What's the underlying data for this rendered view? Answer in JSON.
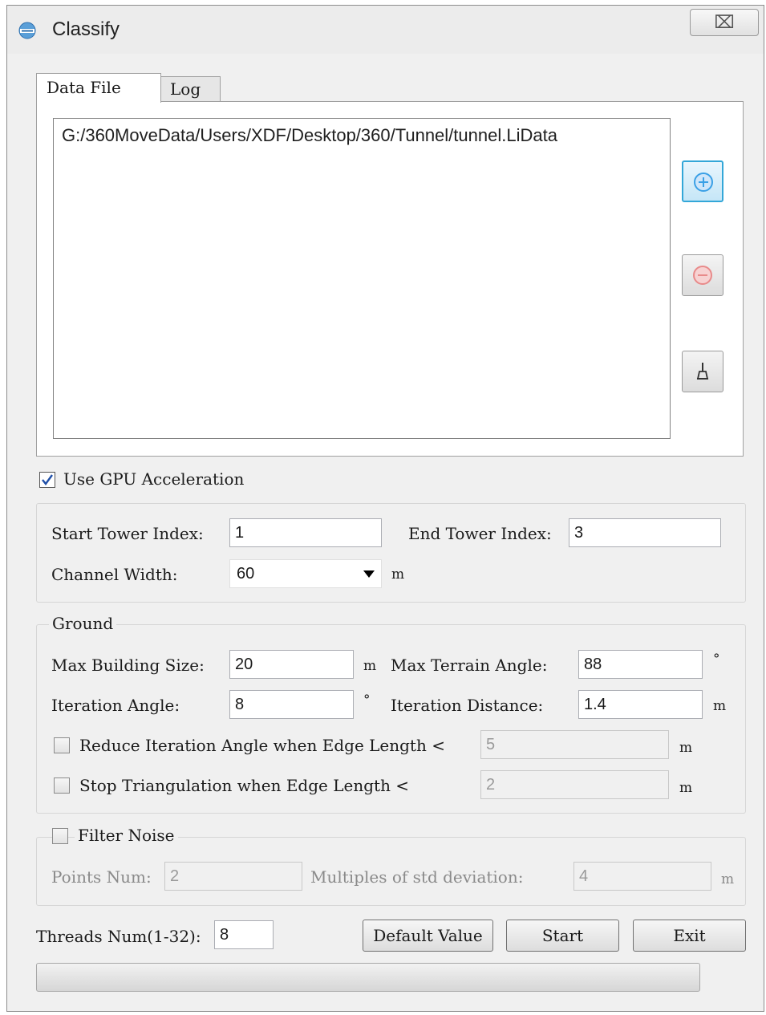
{
  "window": {
    "title": "Classify",
    "close_glyph": "⌧"
  },
  "tabs": [
    {
      "label": "Data File"
    },
    {
      "label": "Log"
    }
  ],
  "file_list": {
    "items": [
      "G:/360MoveData/Users/XDF/Desktop/360/Tunnel/tunnel.LiData"
    ]
  },
  "side_buttons": {
    "add": "add-icon",
    "remove": "remove-icon",
    "clear": "broom-icon"
  },
  "gpu": {
    "label": "Use GPU Acceleration",
    "checked": true
  },
  "tower": {
    "start_label": "Start Tower Index:",
    "start_value": "1",
    "end_label": "End Tower Index:",
    "end_value": "3",
    "channel_label": "Channel Width:",
    "channel_value": "60",
    "channel_unit": "m"
  },
  "ground": {
    "title": "Ground",
    "max_building_label": "Max Building Size:",
    "max_building_value": "20",
    "max_building_unit": "m",
    "max_terrain_label": "Max Terrain Angle:",
    "max_terrain_value": "88",
    "max_terrain_unit": "°",
    "iter_angle_label": "Iteration Angle:",
    "iter_angle_value": "8",
    "iter_angle_unit": "°",
    "iter_distance_label": "Iteration Distance:",
    "iter_distance_value": "1.4",
    "iter_distance_unit": "m",
    "reduce_label": "Reduce Iteration Angle when Edge Length <",
    "reduce_value": "5",
    "reduce_unit": "m",
    "stop_label": "Stop Triangulation when Edge Length <",
    "stop_value": "2",
    "stop_unit": "m"
  },
  "noise": {
    "label": "Filter Noise",
    "points_label": "Points Num:",
    "points_value": "2",
    "std_label": "Multiples of std deviation:",
    "std_value": "4",
    "std_unit": "m"
  },
  "threads": {
    "label": "Threads Num(1-32):",
    "value": "8"
  },
  "buttons": {
    "default": "Default Value",
    "start": "Start",
    "exit": "Exit"
  },
  "colors": {
    "accent": "#33a7d8",
    "add": "#3aa0e6",
    "remove": "#e88a8a"
  }
}
